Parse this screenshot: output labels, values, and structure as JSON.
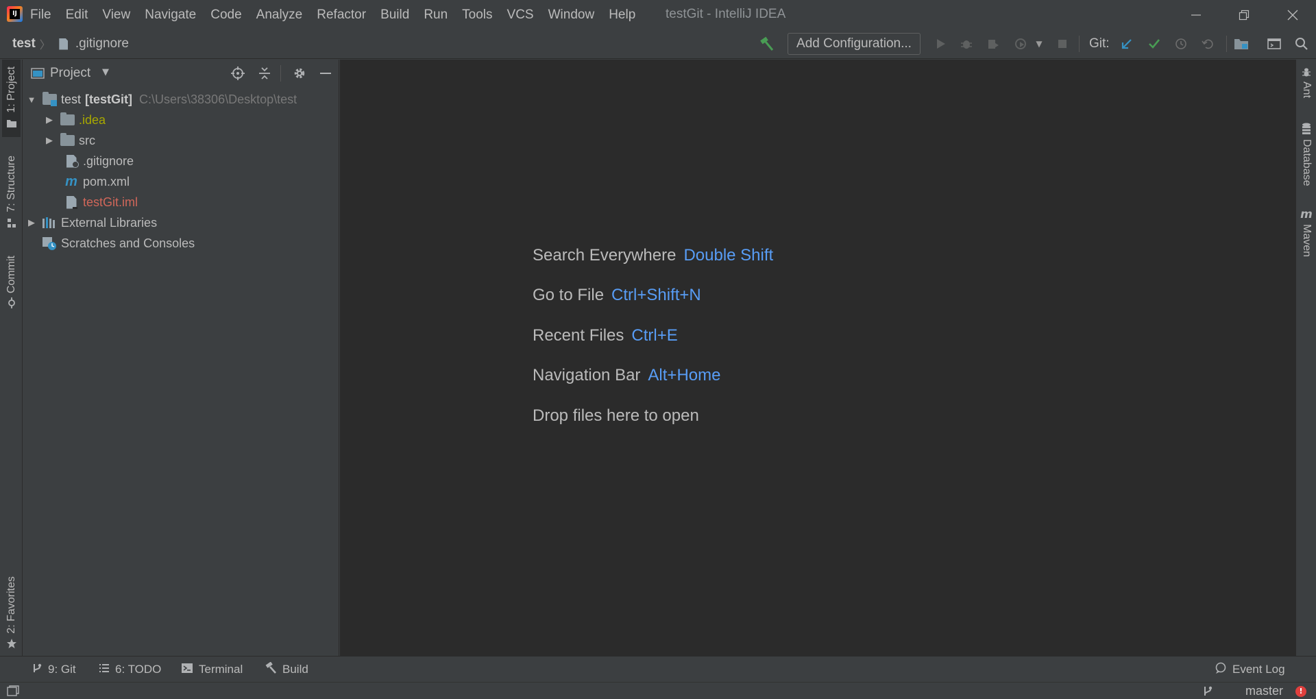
{
  "window": {
    "title": "testGit - IntelliJ IDEA",
    "logo_text": "IJ"
  },
  "menu": {
    "items": [
      "File",
      "Edit",
      "View",
      "Navigate",
      "Code",
      "Analyze",
      "Refactor",
      "Build",
      "Run",
      "Tools",
      "VCS",
      "Window",
      "Help"
    ]
  },
  "breadcrumb": {
    "project": "test",
    "file": ".gitignore"
  },
  "toolbar": {
    "add_configuration_label": "Add Configuration...",
    "git_label": "Git:",
    "colors": {
      "build": "#499c54",
      "update": "#3592c4",
      "commit": "#499c54"
    }
  },
  "left_stripe": {
    "project_tab": "1: Project",
    "structure_tab": "7: Structure",
    "commit_tab": "Commit",
    "favorites_tab": "2: Favorites"
  },
  "project_panel": {
    "title": "Project",
    "tree": {
      "root_name": "test",
      "root_module": "[testGit]",
      "root_path": "C:\\Users\\38306\\Desktop\\test",
      "idea_folder": ".idea",
      "src_folder": "src",
      "gitignore_file": ".gitignore",
      "pom_file": "pom.xml",
      "iml_file": "testGit.iml",
      "external_libraries": "External Libraries",
      "scratches": "Scratches and Consoles"
    },
    "colors": {
      "ignored": "#a8a800",
      "unversioned": "#d1675a",
      "path": "#787878"
    }
  },
  "editor": {
    "hints": [
      {
        "text": "Search Everywhere",
        "key": "Double Shift"
      },
      {
        "text": "Go to File",
        "key": "Ctrl+Shift+N"
      },
      {
        "text": "Recent Files",
        "key": "Ctrl+E"
      },
      {
        "text": "Navigation Bar",
        "key": "Alt+Home"
      },
      {
        "text": "Drop files here to open",
        "key": ""
      }
    ],
    "key_color": "#589df6"
  },
  "right_stripe": {
    "ant_tab": "Ant",
    "database_tab": "Database",
    "maven_tab": "Maven"
  },
  "bottom_bar": {
    "git_tab": "9: Git",
    "todo_tab": "6: TODO",
    "terminal_tab": "Terminal",
    "build_tab": "Build",
    "event_log": "Event Log"
  },
  "status_bar": {
    "branch": "master"
  }
}
